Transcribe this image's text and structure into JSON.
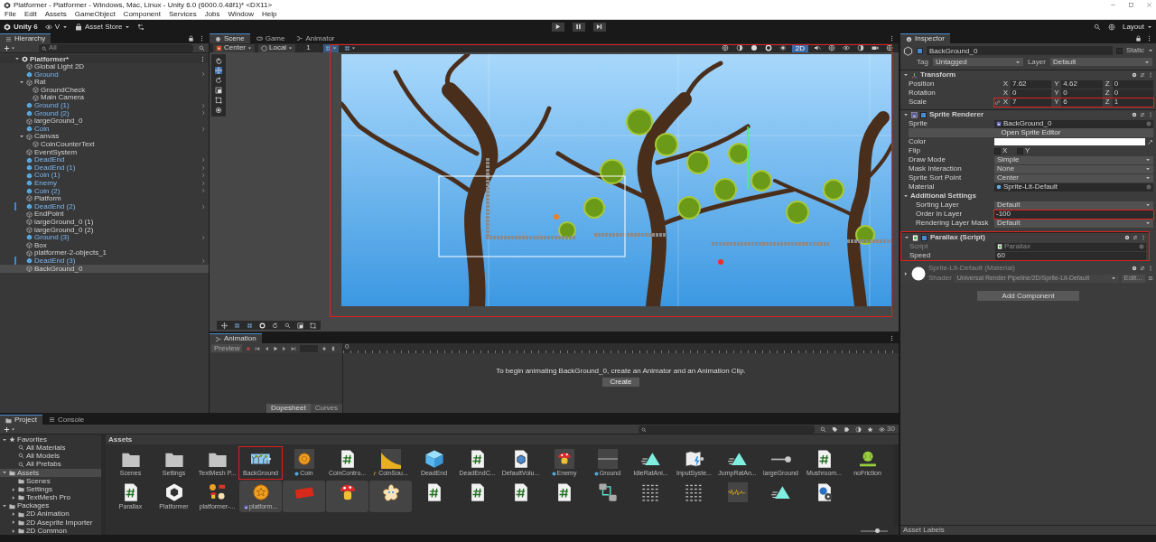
{
  "window": {
    "title": "Platformer - Platformer - Windows, Mac, Linux - Unity 6.0 (6000.0.48f1)* <DX11>"
  },
  "menu": [
    "File",
    "Edit",
    "Assets",
    "GameObject",
    "Component",
    "Services",
    "Jobs",
    "Window",
    "Help"
  ],
  "toolbar": {
    "account": "Unity 6",
    "version_control": "V",
    "asset_store": "Asset Store",
    "layout": "Layout"
  },
  "hierarchy": {
    "tab": "Hierarchy",
    "search_placeholder": "All",
    "scene": {
      "name": "Platformer*",
      "expanded": true,
      "children": [
        {
          "name": "Global Light 2D",
          "prefab": false,
          "selected": false,
          "modified": false
        },
        {
          "name": "Ground",
          "prefab": true,
          "selected": false,
          "modified": false
        },
        {
          "name": "Rat",
          "prefab": false,
          "selected": false,
          "modified": false,
          "expanded": true,
          "children": [
            {
              "name": "GroundCheck",
              "prefab": false,
              "selected": false,
              "modified": false
            },
            {
              "name": "Main Camera",
              "prefab": false,
              "selected": false,
              "modified": false
            }
          ]
        },
        {
          "name": "Ground (1)",
          "prefab": true,
          "selected": false,
          "modified": false
        },
        {
          "name": "Ground (2)",
          "prefab": true,
          "selected": false,
          "modified": false
        },
        {
          "name": "largeGround_0",
          "prefab": false,
          "selected": false,
          "modified": false
        },
        {
          "name": "Coin",
          "prefab": true,
          "selected": false,
          "modified": false
        },
        {
          "name": "Canvas",
          "prefab": false,
          "selected": false,
          "modified": false,
          "expanded": true,
          "children": [
            {
              "name": "CoinCounterText",
              "prefab": false,
              "selected": false,
              "modified": false
            }
          ]
        },
        {
          "name": "EventSystem",
          "prefab": false,
          "selected": false,
          "modified": false
        },
        {
          "name": "DeadEnd",
          "prefab": true,
          "selected": false,
          "modified": false
        },
        {
          "name": "DeadEnd (1)",
          "prefab": true,
          "selected": false,
          "modified": false
        },
        {
          "name": "Coin (1)",
          "prefab": true,
          "selected": false,
          "modified": false
        },
        {
          "name": "Enemy",
          "prefab": true,
          "selected": false,
          "modified": false
        },
        {
          "name": "Coin (2)",
          "prefab": true,
          "selected": false,
          "modified": false
        },
        {
          "name": "Platform",
          "prefab": false,
          "selected": false,
          "modified": false
        },
        {
          "name": "DeadEnd (2)",
          "prefab": true,
          "selected": false,
          "modified": true
        },
        {
          "name": "EndPoint",
          "prefab": false,
          "selected": false,
          "modified": false
        },
        {
          "name": "largeGround_0 (1)",
          "prefab": false,
          "selected": false,
          "modified": false
        },
        {
          "name": "largeGround_0 (2)",
          "prefab": false,
          "selected": false,
          "modified": false
        },
        {
          "name": "Ground (3)",
          "prefab": true,
          "selected": false,
          "modified": false
        },
        {
          "name": "Box",
          "prefab": false,
          "selected": false,
          "modified": false
        },
        {
          "name": "platformer-2-objects_1",
          "prefab": false,
          "selected": false,
          "modified": false
        },
        {
          "name": "DeadEnd (3)",
          "prefab": true,
          "selected": false,
          "modified": true
        },
        {
          "name": "BackGround_0",
          "prefab": false,
          "selected": true,
          "modified": false
        }
      ]
    }
  },
  "scene_view": {
    "tabs": [
      {
        "label": "Scene",
        "selected": true
      },
      {
        "label": "Game",
        "selected": false
      },
      {
        "label": "Animator",
        "selected": false
      }
    ],
    "pivot": "Center",
    "space": "Local",
    "grid_step": "1",
    "mode_2d": {
      "label": "2D",
      "on": true
    },
    "highlighted": true
  },
  "animation": {
    "tab": "Animation",
    "preview": "Preview",
    "ruler_start": "0",
    "message": "To begin animating BackGround_0, create an Animator and an Animation Clip.",
    "create": "Create",
    "tabs": [
      {
        "label": "Dopesheet",
        "selected": true
      },
      {
        "label": "Curves",
        "selected": false
      }
    ]
  },
  "inspector": {
    "tab": "Inspector",
    "object": {
      "name": "BackGround_0",
      "active": true,
      "static_label": "Static",
      "static": false
    },
    "tag_label": "Tag",
    "tag": "Untagged",
    "layer_label": "Layer",
    "layer": "Default",
    "components": [
      {
        "kind": "transform",
        "title": "Transform",
        "expanded": true,
        "rows": [
          {
            "kind": "vector",
            "label": "Position",
            "axes": [
              {
                "axis": "X",
                "value": "7.62"
              },
              {
                "axis": "Y",
                "value": "4.62"
              },
              {
                "axis": "Z",
                "value": "0"
              }
            ]
          },
          {
            "kind": "vector",
            "label": "Rotation",
            "axes": [
              {
                "axis": "X",
                "value": "0"
              },
              {
                "axis": "Y",
                "value": "0"
              },
              {
                "axis": "Z",
                "value": "0"
              }
            ]
          },
          {
            "kind": "scale",
            "label": "Scale",
            "highlighted": true,
            "axes": [
              {
                "axis": "X",
                "value": "7"
              },
              {
                "axis": "Y",
                "value": "6"
              },
              {
                "axis": "Z",
                "value": "1"
              }
            ]
          }
        ]
      },
      {
        "kind": "sprite_renderer",
        "title": "Sprite Renderer",
        "enabled": true,
        "expanded": true,
        "rows": [
          {
            "kind": "sprite_field",
            "label": "Sprite",
            "value": "BackGround_0"
          },
          {
            "kind": "button",
            "label": "Open Sprite Editor"
          },
          {
            "kind": "color",
            "label": "Color",
            "color": "#ffffff"
          },
          {
            "kind": "toggles",
            "label": "Flip",
            "toggles": [
              {
                "label": "X",
                "checked": false
              },
              {
                "label": "Y",
                "checked": false
              }
            ]
          },
          {
            "kind": "dropdown",
            "label": "Draw Mode",
            "value": "Simple"
          },
          {
            "kind": "dropdown",
            "label": "Mask Interaction",
            "value": "None"
          },
          {
            "kind": "dropdown",
            "label": "Sprite Sort Point",
            "value": "Center"
          },
          {
            "kind": "material_field",
            "label": "Material",
            "value": "Sprite-Lit-Default"
          },
          {
            "kind": "section",
            "label": "Additional Settings",
            "expanded": true,
            "rows": [
              {
                "kind": "dropdown",
                "label": "Sorting Layer",
                "value": "Default"
              },
              {
                "kind": "number",
                "label": "Order in Layer",
                "value": "-100",
                "highlighted": true
              },
              {
                "kind": "dropdown",
                "label": "Rendering Layer Mask",
                "value": "Default"
              }
            ]
          }
        ]
      },
      {
        "kind": "script",
        "title": "Parallax (Script)",
        "enabled": true,
        "expanded": true,
        "highlighted": true,
        "rows": [
          {
            "kind": "script_field",
            "label": "Script",
            "value": "Parallax",
            "disabled": true
          },
          {
            "kind": "number",
            "label": "Speed",
            "value": "60"
          }
        ]
      },
      {
        "kind": "material",
        "title": "Sprite-Lit-Default (Material)",
        "shader_label": "Shader",
        "shader": "Universal Render Pipeline/2D/Sprite-Lit-Default",
        "edit": "Edit...",
        "expanded": false
      }
    ],
    "add_component": "Add Component",
    "asset_labels": "Asset Labels"
  },
  "project": {
    "tabs": [
      {
        "label": "Project",
        "selected": true
      },
      {
        "label": "Console",
        "selected": false
      }
    ],
    "count": "30",
    "breadcrumb": "Assets",
    "tree": [
      {
        "label": "Favorites",
        "kind": "favorites",
        "selected": false,
        "expanded": true,
        "children": [
          {
            "label": "All Materials",
            "kind": "search",
            "selected": false
          },
          {
            "label": "All Models",
            "kind": "search",
            "selected": false
          },
          {
            "label": "All Prefabs",
            "kind": "search",
            "selected": false
          }
        ]
      },
      {
        "label": "Assets",
        "kind": "folder",
        "selected": true,
        "expanded": true,
        "children": [
          {
            "label": "Scenes",
            "kind": "folder",
            "selected": false
          },
          {
            "label": "Settings",
            "kind": "folder",
            "selected": false,
            "expanded": false
          },
          {
            "label": "TextMesh Pro",
            "kind": "folder",
            "selected": false,
            "expanded": false
          }
        ]
      },
      {
        "label": "Packages",
        "kind": "folder",
        "selected": false,
        "expanded": true,
        "children": [
          {
            "label": "2D Animation",
            "kind": "folder",
            "selected": false,
            "expanded": false
          },
          {
            "label": "2D Aseprite Importer",
            "kind": "folder",
            "selected": false,
            "expanded": false
          },
          {
            "label": "2D Common",
            "kind": "folder",
            "selected": false,
            "expanded": false
          }
        ]
      }
    ],
    "assets": [
      {
        "label": "Scenes",
        "kind": "folder"
      },
      {
        "label": "Settings",
        "kind": "folder"
      },
      {
        "label": "TextMesh P...",
        "kind": "folder"
      },
      {
        "label": "BackGround",
        "kind": "landscape",
        "highlighted": true
      },
      {
        "label": "Coin",
        "kind": "coin",
        "badge": {
          "kind": "prefab"
        }
      },
      {
        "label": "CoinContro...",
        "kind": "script"
      },
      {
        "label": "CoinSou...",
        "kind": "audio",
        "badge": {
          "kind": "audio"
        }
      },
      {
        "label": "DeadEnd",
        "kind": "cube"
      },
      {
        "label": "DeadEndC...",
        "kind": "script"
      },
      {
        "label": "DefaultVolu...",
        "kind": "volume"
      },
      {
        "label": "Enemy",
        "kind": "enemy",
        "badge": {
          "kind": "prefab"
        }
      },
      {
        "label": "Ground",
        "kind": "ground",
        "badge": {
          "kind": "prefab"
        }
      },
      {
        "label": "IdleRatAni...",
        "kind": "anim"
      },
      {
        "label": "InputSyste...",
        "kind": "input"
      },
      {
        "label": "JumpRatAn...",
        "kind": "anim"
      },
      {
        "label": "largeGround",
        "kind": "line"
      },
      {
        "label": "Mushroom...",
        "kind": "script"
      },
      {
        "label": "noFriction",
        "kind": "physics"
      },
      {
        "label": "Parallax",
        "kind": "script"
      },
      {
        "label": "Platformer",
        "kind": "unity"
      },
      {
        "label": "platformer-...",
        "kind": "multi"
      },
      {
        "label": "platform...",
        "kind": "coinbig",
        "badge": {
          "kind": "sprite"
        },
        "grouped": true
      },
      {
        "kind": "exit",
        "grouped": true
      },
      {
        "kind": "mushroom",
        "grouped": true
      },
      {
        "kind": "flower",
        "grouped": true
      },
      {
        "kind": "script"
      },
      {
        "kind": "script"
      },
      {
        "kind": "script"
      },
      {
        "kind": "script"
      },
      {
        "kind": "graph"
      },
      {
        "kind": "tiles"
      },
      {
        "kind": "tiles"
      },
      {
        "kind": "wave"
      },
      {
        "kind": "anim"
      },
      {
        "kind": "settings"
      }
    ],
    "zoom_slider": {
      "level": 0.6
    }
  }
}
